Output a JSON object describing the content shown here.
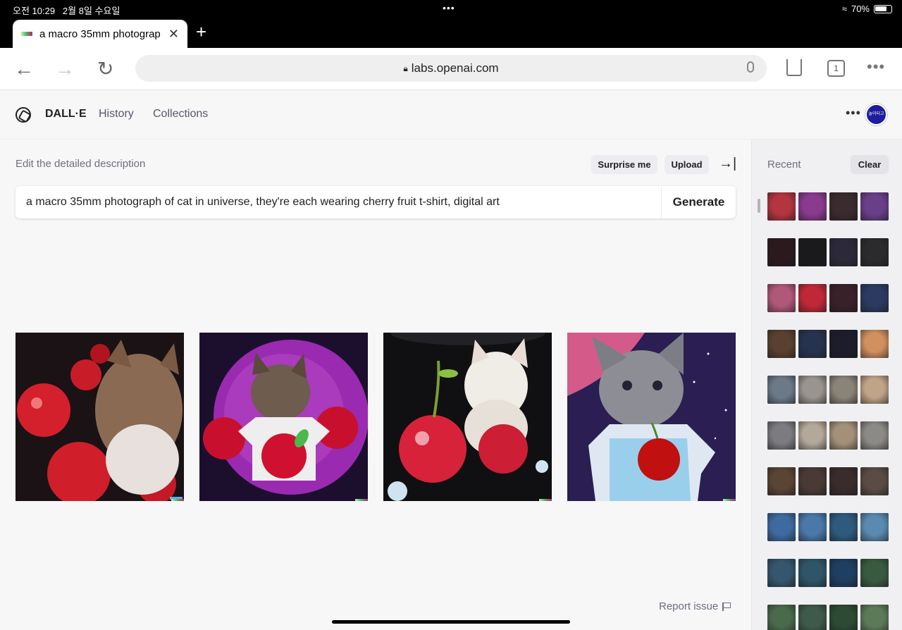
{
  "status_bar": {
    "time": "오전 10:29",
    "date": "2월 8일 수요일",
    "battery": "70%"
  },
  "browser": {
    "tab_title": "a macro 35mm photograp",
    "url": "labs.openai.com",
    "tab_count": "1"
  },
  "header": {
    "brand": "DALL·E",
    "nav": [
      "History",
      "Collections"
    ],
    "avatar_text": "놀이터고객"
  },
  "editor": {
    "label": "Edit the detailed description",
    "surprise_label": "Surprise me",
    "upload_label": "Upload",
    "prompt": "a macro 35mm photograph of cat in universe, they're each wearing cherry fruit t-shirt, digital art",
    "generate_label": "Generate"
  },
  "results": [
    {
      "icon": "cat-cherries-image",
      "bg": "#1a1214",
      "accent": "#d4202c",
      "cat": "#8a6a52"
    },
    {
      "icon": "cat-tshirt-galaxy-image",
      "bg": "#7a1f8a",
      "accent": "#c8102e",
      "cat": "#6e5c4e"
    },
    {
      "icon": "white-cat-cherries-image",
      "bg": "#101012",
      "accent": "#d8223a",
      "cat": "#f0ece6"
    },
    {
      "icon": "grey-cat-space-image",
      "bg": "#3a2a66",
      "accent": "#c01010",
      "cat": "#8d8d96"
    }
  ],
  "footer": {
    "report_label": "Report issue"
  },
  "sidebar": {
    "title": "Recent",
    "clear_label": "Clear",
    "thumb_colors": [
      "#b43440",
      "#8a3b8e",
      "#3a2b2f",
      "#6a3f8a",
      "#2a1a1e",
      "#1a1a1c",
      "#2c2a3a",
      "#2b2b2e",
      "#b05878",
      "#c02838",
      "#3a2028",
      "#2a3a60",
      "#5a4030",
      "#26334e",
      "#1c1c2a",
      "#d09060",
      "#6c7a88",
      "#9a948e",
      "#8a8478",
      "#c0a488",
      "#7c7c80",
      "#b4a89a",
      "#a49078",
      "#8c8a86",
      "#5a4434",
      "#4a3a36",
      "#3a2c2a",
      "#5a4c44",
      "#3e6aa0",
      "#4a78a8",
      "#2e5a7e",
      "#5a8ab0",
      "#34566e",
      "#2e5668",
      "#1e3e62",
      "#3a5a40",
      "#4a6a4c",
      "#3e5a4a",
      "#2c4a34",
      "#5c7a58"
    ]
  }
}
